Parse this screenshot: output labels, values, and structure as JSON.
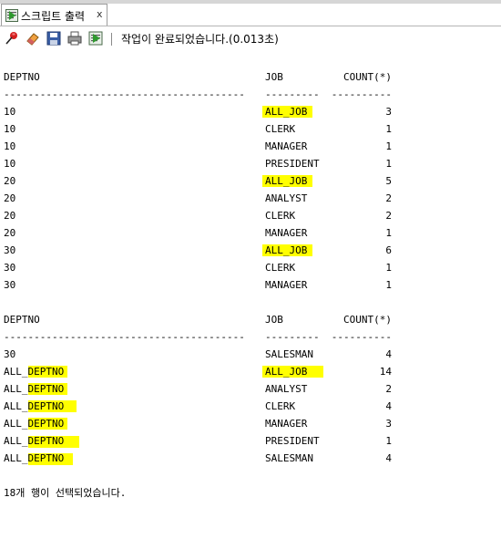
{
  "tab": {
    "label": "스크립트 출력",
    "close": "x"
  },
  "toolbar": {
    "status": "작업이 완료되었습니다.(0.013초)"
  },
  "table1": {
    "headers": {
      "deptno": "DEPTNO",
      "job": "JOB",
      "count": "COUNT(*)"
    },
    "separators": {
      "deptno": "----------------------------------------",
      "job": "---------",
      "count": "----------"
    },
    "rows": [
      {
        "deptno": "10",
        "job": "ALL_JOB",
        "count": "3"
      },
      {
        "deptno": "10",
        "job": "CLERK",
        "count": "1"
      },
      {
        "deptno": "10",
        "job": "MANAGER",
        "count": "1"
      },
      {
        "deptno": "10",
        "job": "PRESIDENT",
        "count": "1"
      },
      {
        "deptno": "20",
        "job": "ALL_JOB",
        "count": "5"
      },
      {
        "deptno": "20",
        "job": "ANALYST",
        "count": "2"
      },
      {
        "deptno": "20",
        "job": "CLERK",
        "count": "2"
      },
      {
        "deptno": "20",
        "job": "MANAGER",
        "count": "1"
      },
      {
        "deptno": "30",
        "job": "ALL_JOB",
        "count": "6"
      },
      {
        "deptno": "30",
        "job": "CLERK",
        "count": "1"
      },
      {
        "deptno": "30",
        "job": "MANAGER",
        "count": "1"
      }
    ]
  },
  "table2": {
    "headers": {
      "deptno": "DEPTNO",
      "job": "JOB",
      "count": "COUNT(*)"
    },
    "separators": {
      "deptno": "----------------------------------------",
      "job": "---------",
      "count": "----------"
    },
    "rows": [
      {
        "deptno": "30",
        "job": "SALESMAN",
        "count": "4"
      },
      {
        "deptno": "ALL_DEPTNO",
        "job": "ALL_JOB",
        "count": "14"
      },
      {
        "deptno": "ALL_DEPTNO",
        "job": "ANALYST",
        "count": "2"
      },
      {
        "deptno": "ALL_DEPTNO",
        "job": "CLERK",
        "count": "4"
      },
      {
        "deptno": "ALL_DEPTNO",
        "job": "MANAGER",
        "count": "3"
      },
      {
        "deptno": "ALL_DEPTNO",
        "job": "PRESIDENT",
        "count": "1"
      },
      {
        "deptno": "ALL_DEPTNO",
        "job": "SALESMAN",
        "count": "4"
      }
    ]
  },
  "footer": {
    "message": "18개 행이 선택되었습니다."
  },
  "colors": {
    "highlight": "#ffff00",
    "footer_number": "#6f6f6f"
  }
}
